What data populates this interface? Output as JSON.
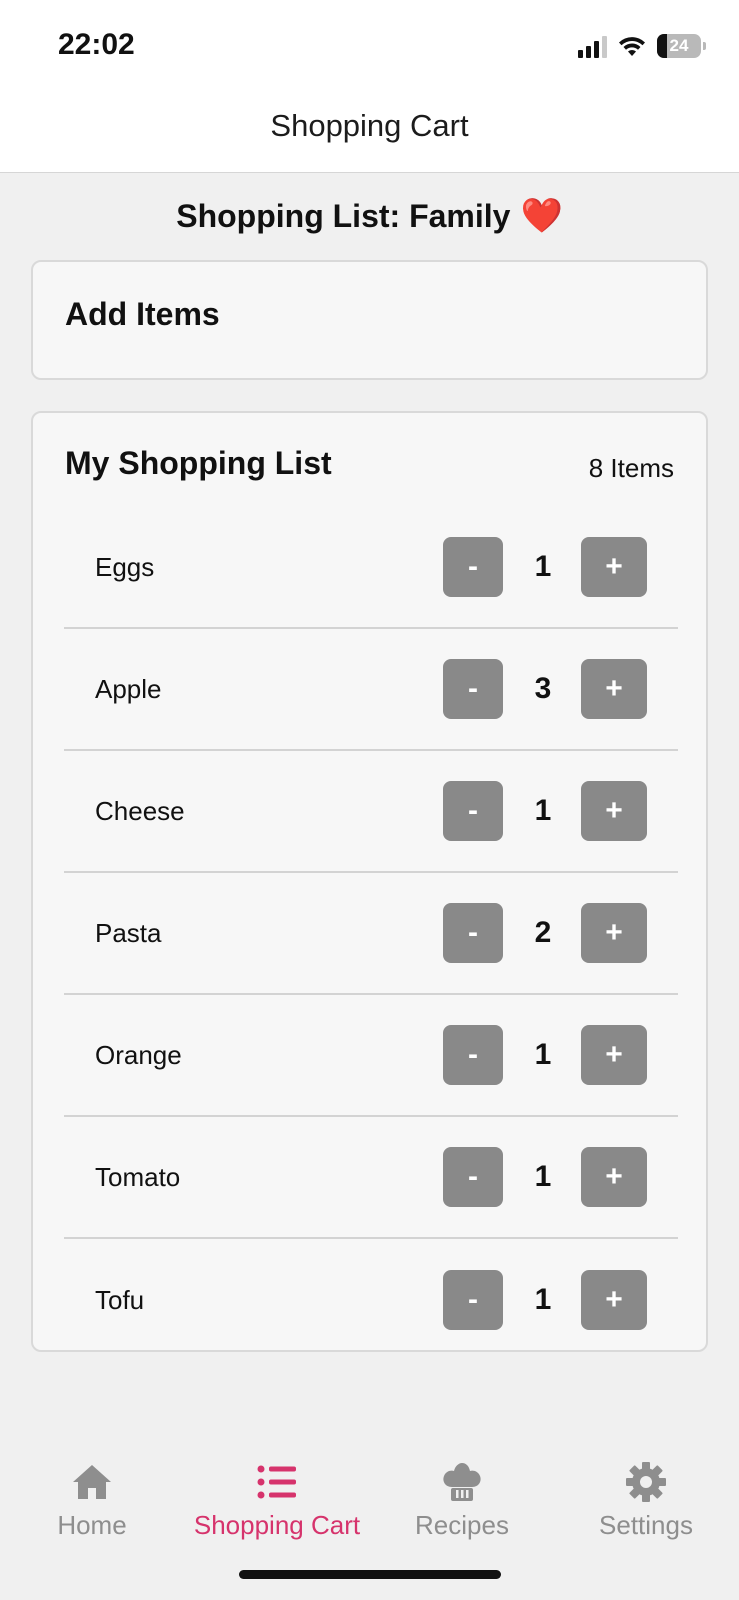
{
  "status_bar": {
    "time": "22:02",
    "battery": "24"
  },
  "header": {
    "title": "Shopping Cart"
  },
  "list_title": {
    "text": "Shopping List: Family",
    "emoji": "❤️"
  },
  "add_items": {
    "title": "Add Items"
  },
  "shopping_list": {
    "title": "My Shopping List",
    "count": "8 Items",
    "items": [
      {
        "name": "Eggs",
        "qty": "1"
      },
      {
        "name": "Apple",
        "qty": "3"
      },
      {
        "name": "Cheese",
        "qty": "1"
      },
      {
        "name": "Pasta",
        "qty": "2"
      },
      {
        "name": "Orange",
        "qty": "1"
      },
      {
        "name": "Tomato",
        "qty": "1"
      },
      {
        "name": "Tofu",
        "qty": "1"
      }
    ],
    "minus_label": "-",
    "plus_label": "+"
  },
  "tabs": [
    {
      "label": "Home",
      "icon": "home-icon",
      "active": false
    },
    {
      "label": "Shopping Cart",
      "icon": "list-icon",
      "active": true
    },
    {
      "label": "Recipes",
      "icon": "chef-hat-icon",
      "active": false
    },
    {
      "label": "Settings",
      "icon": "gear-icon",
      "active": false
    }
  ],
  "colors": {
    "accent": "#d6336c",
    "inactive": "#8e8e8e",
    "button": "#898989"
  }
}
